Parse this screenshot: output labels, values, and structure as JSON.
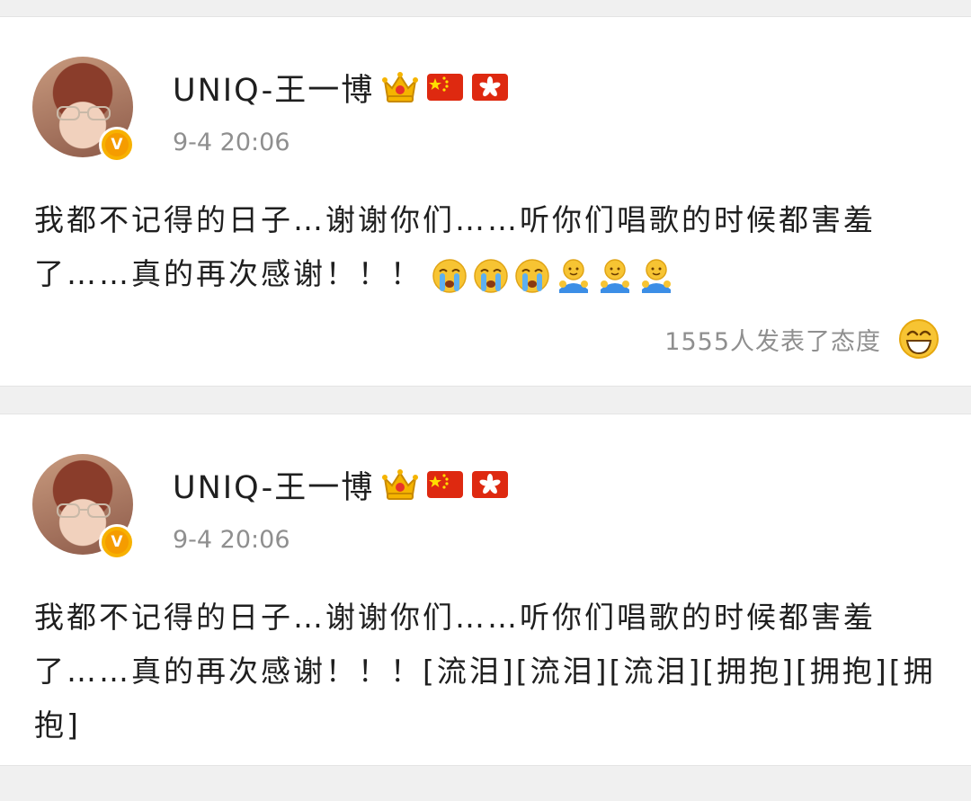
{
  "colors": {
    "background": "#f0f0f0",
    "card": "#ffffff",
    "text": "#1f1f1f",
    "muted": "#8f8f8f",
    "verified": "#f7b100"
  },
  "posts": [
    {
      "username": "UNIQ-王一博",
      "badges": [
        "crown-icon",
        "china-flag-icon",
        "hong-kong-flag-icon"
      ],
      "timestamp": "9-4 20:06",
      "text": "我都不记得的日子…谢谢你们……听你们唱歌的时候都害羞了……真的再次感谢！！！",
      "emojis": [
        "crying-emoji-icon",
        "crying-emoji-icon",
        "crying-emoji-icon",
        "hug-emoji-icon",
        "hug-emoji-icon",
        "hug-emoji-icon"
      ],
      "reaction_text": "1555人发表了态度",
      "reaction_icon": "laughing-face-icon"
    },
    {
      "username": "UNIQ-王一博",
      "badges": [
        "crown-icon",
        "china-flag-icon",
        "hong-kong-flag-icon"
      ],
      "timestamp": "9-4 20:06",
      "text": "我都不记得的日子…谢谢你们……听你们唱歌的时候都害羞了……真的再次感谢！！！[流泪][流泪][流泪][拥抱][拥抱][拥抱]"
    }
  ]
}
